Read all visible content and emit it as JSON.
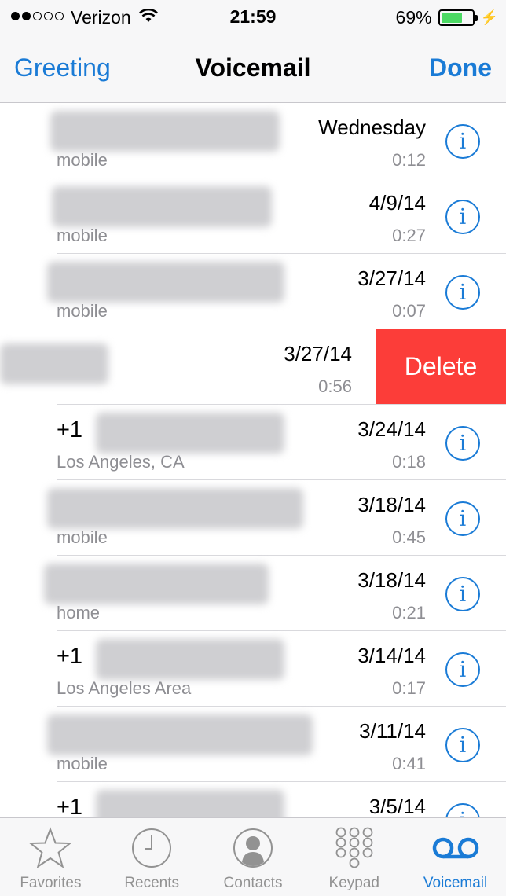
{
  "status_bar": {
    "carrier": "Verizon",
    "time": "21:59",
    "battery_percent": "69%",
    "battery_level": 0.69,
    "signal_bars_filled": 2,
    "signal_bars_total": 5
  },
  "nav": {
    "left": "Greeting",
    "title": "Voicemail",
    "right": "Done"
  },
  "voicemails": [
    {
      "prefix": "",
      "date": "Wednesday",
      "subtitle": "mobile",
      "duration": "0:12"
    },
    {
      "prefix": "",
      "date": "4/9/14",
      "subtitle": "mobile",
      "duration": "0:27"
    },
    {
      "prefix": "",
      "date": "3/27/14",
      "subtitle": "mobile",
      "duration": "0:07"
    },
    {
      "prefix": "",
      "date": "3/27/14",
      "subtitle": "",
      "duration": "0:56",
      "swiped": true
    },
    {
      "prefix": "+1",
      "date": "3/24/14",
      "subtitle": "Los Angeles, CA",
      "duration": "0:18"
    },
    {
      "prefix": "",
      "date": "3/18/14",
      "subtitle": "mobile",
      "duration": "0:45"
    },
    {
      "prefix": "",
      "date": "3/18/14",
      "subtitle": "home",
      "duration": "0:21"
    },
    {
      "prefix": "+1",
      "date": "3/14/14",
      "subtitle": "Los Angeles Area",
      "duration": "0:17"
    },
    {
      "prefix": "",
      "date": "3/11/14",
      "subtitle": "mobile",
      "duration": "0:41"
    },
    {
      "prefix": "+1",
      "date": "3/5/14",
      "subtitle": "",
      "duration": ""
    }
  ],
  "delete_label": "Delete",
  "info_glyph": "i",
  "tabs": [
    {
      "label": "Favorites",
      "icon": "star-icon"
    },
    {
      "label": "Recents",
      "icon": "clock-icon"
    },
    {
      "label": "Contacts",
      "icon": "person-icon"
    },
    {
      "label": "Keypad",
      "icon": "keypad-icon"
    },
    {
      "label": "Voicemail",
      "icon": "voicemail-icon",
      "active": true
    }
  ],
  "colors": {
    "accent": "#1a7bd6",
    "delete": "#fc3d39",
    "battery": "#4cd964",
    "secondary_text": "#8e8e93"
  }
}
